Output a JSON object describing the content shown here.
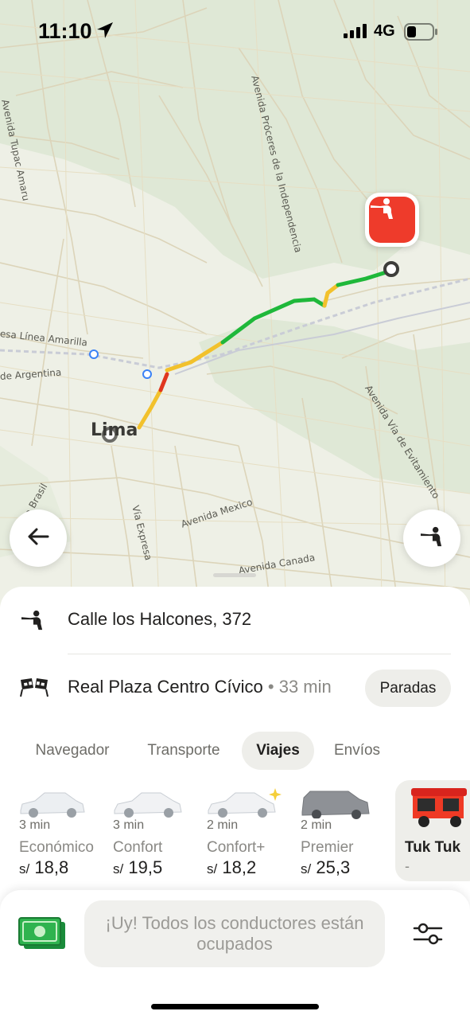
{
  "status_bar": {
    "time": "11:10",
    "network": "4G",
    "icons": [
      "location-arrow-icon",
      "signal-icon",
      "battery-icon"
    ]
  },
  "map": {
    "city_label": "Lima",
    "street_labels": [
      "Avenida Tupac Amaru",
      "Avenida Próceres de la Independencia",
      "esa Línea Amarilla",
      "de Argentina",
      "Avenida Vía de Evitamiento",
      "Vía Expresa",
      "Avenida Mexico",
      "Avenida Canada",
      "a Brasil"
    ],
    "route_colors": [
      "#1fb83a",
      "#f2c12c",
      "#f07f1a",
      "#e0361f"
    ],
    "pin_color": "#ee3b2b"
  },
  "buttons": {
    "back_icon": "arrow-left-icon",
    "pickup_icon": "person-hail-icon"
  },
  "route": {
    "origin": "Calle los Halcones, 372",
    "destination": "Real Plaza Centro Cívico",
    "destination_eta": "• 33 min",
    "stops_button": "Paradas"
  },
  "tabs": [
    {
      "label": "Navegador",
      "active": false
    },
    {
      "label": "Transporte",
      "active": false
    },
    {
      "label": "Viajes",
      "active": true
    },
    {
      "label": "Envíos",
      "active": false
    }
  ],
  "tariffs": [
    {
      "eta": "3 min",
      "name": "Económico",
      "currency": "s/",
      "price": "18,8"
    },
    {
      "eta": "3 min",
      "name": "Confort",
      "currency": "s/",
      "price": "19,5"
    },
    {
      "eta": "2 min",
      "name": "Confort+",
      "currency": "s/",
      "price": "18,2"
    },
    {
      "eta": "2 min",
      "name": "Premier",
      "currency": "s/",
      "price": "25,3"
    },
    {
      "name": "Tuk Tuk",
      "price": "-",
      "selected": true
    }
  ],
  "order": {
    "message": "¡Uy! Todos los conductores están ocupados",
    "payment_icon": "cash-icon",
    "settings_icon": "sliders-icon"
  }
}
